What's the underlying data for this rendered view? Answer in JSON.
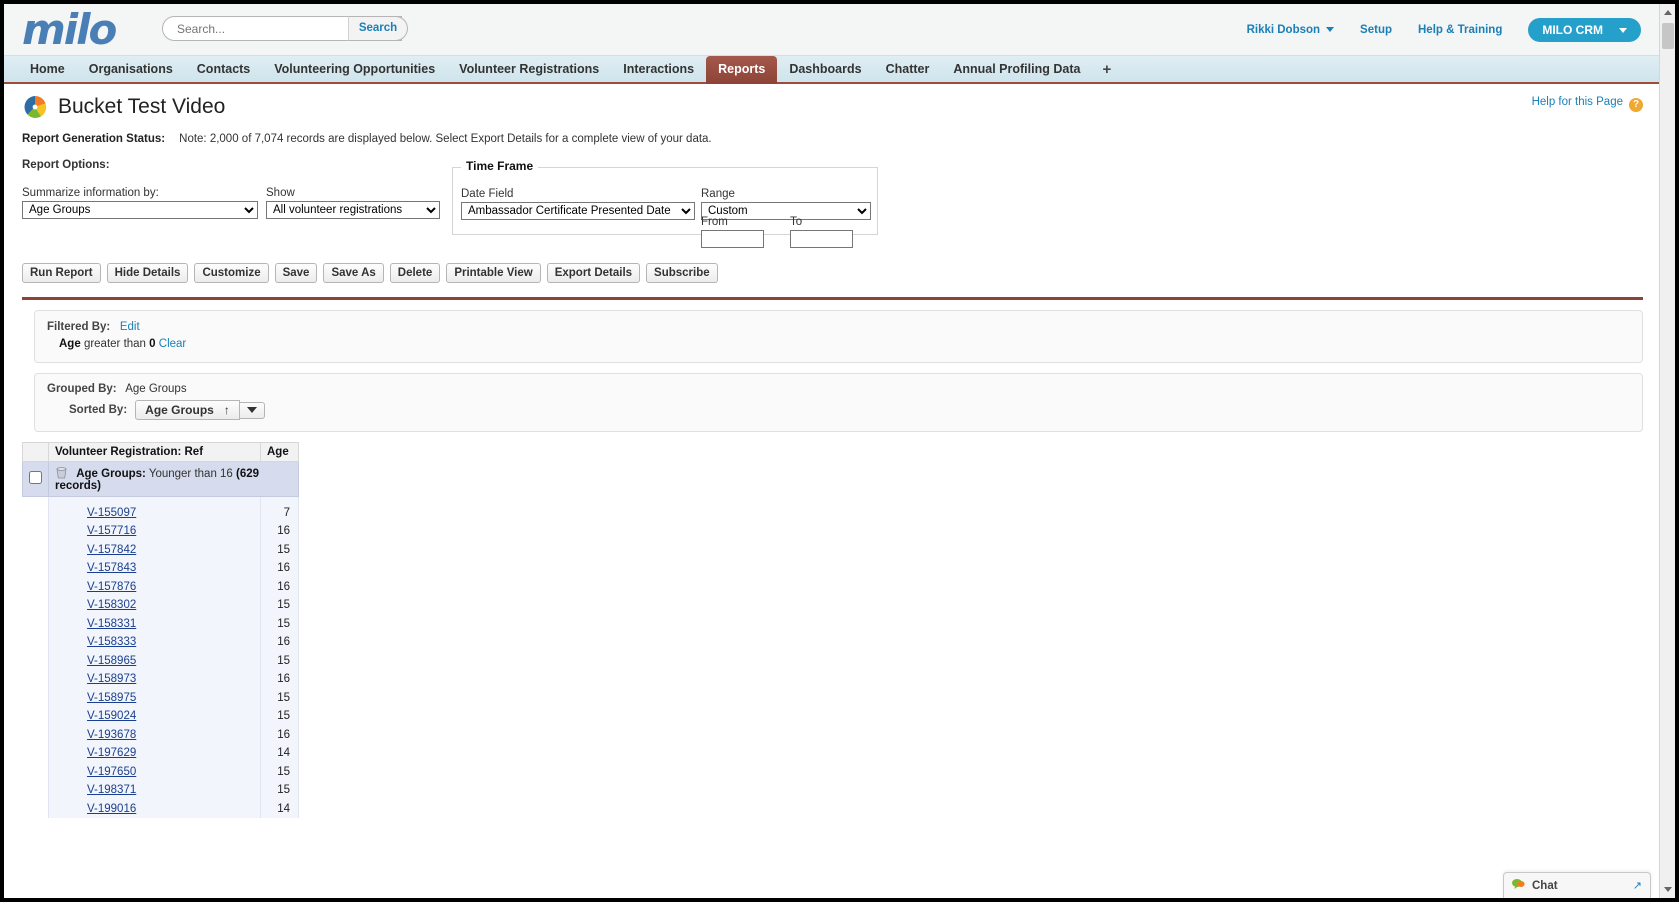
{
  "header": {
    "logo_text": "milo",
    "search_placeholder": "Search...",
    "search_value": "",
    "search_button": "Search",
    "user_name": "Rikki Dobson",
    "setup_link": "Setup",
    "help_training_link": "Help & Training",
    "app_button": "MILO CRM"
  },
  "nav": {
    "tabs": [
      {
        "label": "Home",
        "active": false
      },
      {
        "label": "Organisations",
        "active": false
      },
      {
        "label": "Contacts",
        "active": false
      },
      {
        "label": "Volunteering Opportunities",
        "active": false
      },
      {
        "label": "Volunteer Registrations",
        "active": false
      },
      {
        "label": "Interactions",
        "active": false
      },
      {
        "label": "Reports",
        "active": true
      },
      {
        "label": "Dashboards",
        "active": false
      },
      {
        "label": "Chatter",
        "active": false
      },
      {
        "label": "Annual Profiling Data",
        "active": false
      }
    ],
    "add_tab": "+"
  },
  "page": {
    "title": "Bucket Test Video",
    "help_for_page": "Help for this Page",
    "help_icon_glyph": "?",
    "status_label": "Report Generation Status:",
    "status_note": "Note: 2,000 of 7,074 records are displayed below. Select Export Details for a complete view of your data.",
    "report_options_label": "Report Options:"
  },
  "options": {
    "summarize_label": "Summarize information by:",
    "summarize_value": "Age Groups",
    "show_label": "Show",
    "show_value": "All volunteer registrations",
    "time_frame_legend": "Time Frame",
    "date_field_label": "Date Field",
    "date_field_value": "Ambassador Certificate Presented Date",
    "range_label": "Range",
    "range_value": "Custom",
    "from_label": "From",
    "from_value": "",
    "to_label": "To",
    "to_value": ""
  },
  "buttons": [
    "Run Report",
    "Hide Details",
    "Customize",
    "Save",
    "Save As",
    "Delete",
    "Printable View",
    "Export Details",
    "Subscribe"
  ],
  "filter_panel": {
    "filtered_by_label": "Filtered By:",
    "edit_link": "Edit",
    "criteria_field": "Age",
    "criteria_operator": "greater than",
    "criteria_value": "0",
    "clear_link": "Clear"
  },
  "group_panel": {
    "grouped_by_label": "Grouped By:",
    "grouped_by_value": "Age Groups",
    "sorted_by_label": "Sorted By:",
    "sorted_by_value": "Age Groups",
    "sort_direction_glyph": "↑"
  },
  "table": {
    "columns": [
      "Volunteer Registration: Ref",
      "Age"
    ],
    "group": {
      "label_prefix": "Age Groups:",
      "bucket_name": "Younger than 16",
      "record_count": "(629 records)"
    },
    "rows": [
      {
        "ref": "V-155097",
        "age": "7"
      },
      {
        "ref": "V-157716",
        "age": "16"
      },
      {
        "ref": "V-157842",
        "age": "15"
      },
      {
        "ref": "V-157843",
        "age": "16"
      },
      {
        "ref": "V-157876",
        "age": "16"
      },
      {
        "ref": "V-158302",
        "age": "15"
      },
      {
        "ref": "V-158331",
        "age": "15"
      },
      {
        "ref": "V-158333",
        "age": "16"
      },
      {
        "ref": "V-158965",
        "age": "15"
      },
      {
        "ref": "V-158973",
        "age": "16"
      },
      {
        "ref": "V-158975",
        "age": "15"
      },
      {
        "ref": "V-159024",
        "age": "15"
      },
      {
        "ref": "V-193678",
        "age": "16"
      },
      {
        "ref": "V-197629",
        "age": "14"
      },
      {
        "ref": "V-197650",
        "age": "15"
      },
      {
        "ref": "V-198371",
        "age": "15"
      },
      {
        "ref": "V-199016",
        "age": "14"
      }
    ]
  },
  "chat": {
    "label": "Chat",
    "expand_glyph": "↗"
  }
}
